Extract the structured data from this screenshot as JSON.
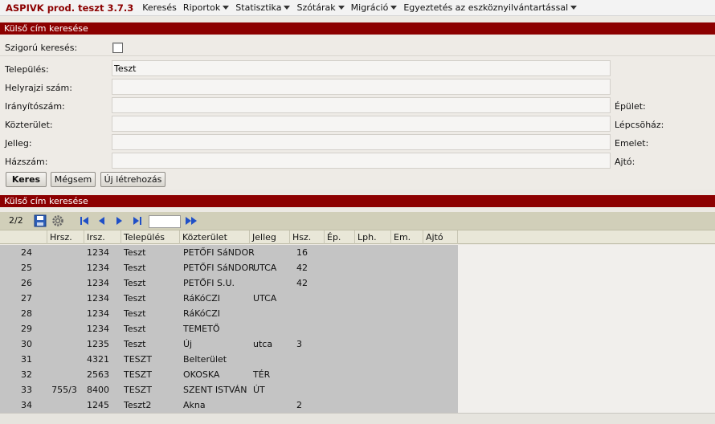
{
  "menubar": {
    "brand": "ASPIVK prod. teszt 3.7.3",
    "items": [
      {
        "label": "Keresés"
      },
      {
        "label": "Riportok"
      },
      {
        "label": "Statisztika"
      },
      {
        "label": "Szótárak"
      },
      {
        "label": "Migráció"
      },
      {
        "label": "Egyeztetés az eszköznyilvántartással"
      }
    ]
  },
  "search_panel": {
    "title": "Külső cím keresése",
    "strict_label": "Szigorú keresés:",
    "strict_checked": false,
    "fields": {
      "telepules": {
        "label": "Település:",
        "value": "Teszt"
      },
      "hrsz": {
        "label": "Helyrajzi szám:",
        "value": ""
      },
      "irsz": {
        "label": "Irányítószám:",
        "value": ""
      },
      "kozterulet": {
        "label": "Közterület:",
        "value": ""
      },
      "jelleg": {
        "label": "Jelleg:",
        "value": ""
      },
      "hazszam": {
        "label": "Házszám:",
        "value": ""
      }
    },
    "right_labels": {
      "epulet": "Épület:",
      "lepcsohaz": "Lépcsõház:",
      "emelet": "Emelet:",
      "ajto": "Ajtó:"
    },
    "buttons": {
      "search": "Keres",
      "cancel": "Mégsem",
      "create": "Új létrehozás"
    }
  },
  "results_panel": {
    "title": "Külső cím keresése",
    "page_indicator": "2/2",
    "page_input": "",
    "columns": [
      "Hrsz.",
      "Irsz.",
      "Település",
      "Közterület",
      "Jelleg",
      "Hsz.",
      "Ép.",
      "Lph.",
      "Em.",
      "Ajtó"
    ],
    "rows": [
      {
        "n": "24",
        "hrsz": "",
        "irsz": "1234",
        "telepules": "Teszt",
        "kozterulet": "PETŐFI SáNDOR",
        "jelleg": "",
        "hsz": "16"
      },
      {
        "n": "25",
        "hrsz": "",
        "irsz": "1234",
        "telepules": "Teszt",
        "kozterulet": "PETŐFI SáNDOR",
        "jelleg": "UTCA",
        "hsz": "42"
      },
      {
        "n": "26",
        "hrsz": "",
        "irsz": "1234",
        "telepules": "Teszt",
        "kozterulet": "PETŐFI S.U.",
        "jelleg": "",
        "hsz": "42"
      },
      {
        "n": "27",
        "hrsz": "",
        "irsz": "1234",
        "telepules": "Teszt",
        "kozterulet": "RáKóCZI",
        "jelleg": "UTCA",
        "hsz": ""
      },
      {
        "n": "28",
        "hrsz": "",
        "irsz": "1234",
        "telepules": "Teszt",
        "kozterulet": "RáKóCZI",
        "jelleg": "",
        "hsz": ""
      },
      {
        "n": "29",
        "hrsz": "",
        "irsz": "1234",
        "telepules": "Teszt",
        "kozterulet": "TEMETŐ",
        "jelleg": "",
        "hsz": ""
      },
      {
        "n": "30",
        "hrsz": "",
        "irsz": "1235",
        "telepules": "Teszt",
        "kozterulet": "Új",
        "jelleg": "utca",
        "hsz": "3"
      },
      {
        "n": "31",
        "hrsz": "",
        "irsz": "4321",
        "telepules": "TESZT",
        "kozterulet": "Belterület",
        "jelleg": "",
        "hsz": ""
      },
      {
        "n": "32",
        "hrsz": "",
        "irsz": "2563",
        "telepules": "TESZT",
        "kozterulet": "OKOSKA",
        "jelleg": "TÉR",
        "hsz": ""
      },
      {
        "n": "33",
        "hrsz": "755/3",
        "irsz": "8400",
        "telepules": "TESZT",
        "kozterulet": "SZENT ISTVÁN",
        "jelleg": "ÚT",
        "hsz": ""
      },
      {
        "n": "34",
        "hrsz": "",
        "irsz": "1245",
        "telepules": "Teszt2",
        "kozterulet": "Akna",
        "jelleg": "",
        "hsz": "2"
      }
    ]
  },
  "colors": {
    "header_bg": "#8c0000",
    "brand": "#8c0000",
    "toolbar_bg": "#d1cfb9",
    "grid_bg": "#c4c4c4",
    "nav_icon": "#1f4fc7"
  },
  "icons": {
    "save": "save-icon",
    "settings": "gear-icon",
    "first": "first-page-icon",
    "prev": "prev-page-icon",
    "next": "next-page-icon",
    "last": "last-page-icon",
    "go": "go-page-icon"
  }
}
